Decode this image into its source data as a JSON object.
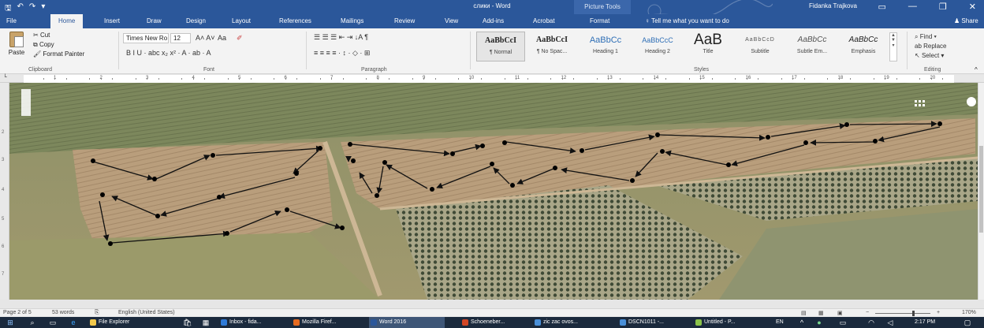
{
  "app": {
    "title": "слики - Word",
    "picture_tools": "Picture Tools",
    "user": "Fidanka Trajkova",
    "quick_access": [
      "save-icon",
      "undo-icon",
      "redo-icon",
      "customize-icon"
    ]
  },
  "tabs": [
    {
      "label": "File",
      "active": false
    },
    {
      "label": "Home",
      "active": true
    },
    {
      "label": "Insert",
      "active": false
    },
    {
      "label": "Draw",
      "active": false
    },
    {
      "label": "Design",
      "active": false
    },
    {
      "label": "Layout",
      "active": false
    },
    {
      "label": "References",
      "active": false
    },
    {
      "label": "Mailings",
      "active": false
    },
    {
      "label": "Review",
      "active": false
    },
    {
      "label": "View",
      "active": false
    },
    {
      "label": "Add-ins",
      "active": false
    },
    {
      "label": "Acrobat",
      "active": false
    },
    {
      "label": "Format",
      "active": false
    }
  ],
  "tell_me": "Tell me what you want to do",
  "share": "Share",
  "clipboard": {
    "paste": "Paste",
    "cut": "Cut",
    "copy": "Copy",
    "format_painter": "Format Painter",
    "group_label": "Clipboard"
  },
  "font": {
    "family": "Times New Ro",
    "size": "12",
    "change_case": "Aa",
    "group_label": "Font",
    "row2": "B  I  U  ·  abc  x₂  x²  ·  A  ·  ab  ·  A"
  },
  "paragraph": {
    "row1": "☰  ☰  ☰  ⇤  ⇥  ↓A  ¶",
    "row2": "≡  ≡  ≡  ≡  ·  ↕  ·  ◇  ·  ⊞",
    "group_label": "Paragraph"
  },
  "styles": {
    "items": [
      {
        "sample": "AaBbCcI",
        "name": "¶ Normal",
        "color": "#111111",
        "selected": true
      },
      {
        "sample": "AaBbCcI",
        "name": "¶ No Spac...",
        "color": "#111111",
        "selected": false
      },
      {
        "sample": "AaBbCc",
        "name": "Heading 1",
        "color": "#2f6fb6",
        "selected": false
      },
      {
        "sample": "AaBbCcC",
        "name": "Heading 2",
        "color": "#2f6fb6",
        "selected": false
      },
      {
        "sample": "AaB",
        "name": "Title",
        "color": "#222222",
        "selected": false
      },
      {
        "sample": "AaBbCcD",
        "name": "Subtitle",
        "color": "#555555",
        "selected": false
      },
      {
        "sample": "AaBbCc",
        "name": "Subtle Em...",
        "color": "#555555",
        "selected": false
      },
      {
        "sample": "AaBbCc",
        "name": "Emphasis",
        "color": "#333333",
        "selected": false
      }
    ],
    "group_label": "Styles"
  },
  "editing": {
    "find": "Find",
    "replace": "Replace",
    "select": "Select",
    "group_label": "Editing"
  },
  "ruler": {
    "numbers": [
      "1",
      "2",
      "3",
      "4",
      "5",
      "6",
      "7",
      "8",
      "9",
      "10",
      "11",
      "12",
      "13",
      "14",
      "15",
      "16",
      "17",
      "18",
      "19",
      "20"
    ]
  },
  "status": {
    "page": "Page 2 of 5",
    "words": "53 words",
    "language": "English (United States)",
    "zoom": "170%"
  },
  "taskbar": {
    "items": [
      {
        "label": "File Explorer",
        "color": "#f2c94c",
        "active": false
      },
      {
        "label": "Inbox - fida...",
        "color": "#2f7bd8",
        "active": false
      },
      {
        "label": "Mozilla Firef...",
        "color": "#e66a1f",
        "active": false
      },
      {
        "label": "Word 2016",
        "color": "#2b579a",
        "active": true
      },
      {
        "label": "Schoeneber...",
        "color": "#d24726",
        "active": false
      },
      {
        "label": "zic zac ovos...",
        "color": "#4a90d9",
        "active": false
      },
      {
        "label": "DSCN1011 -...",
        "color": "#4a90d9",
        "active": false
      },
      {
        "label": "Untitled - P...",
        "color": "#8bc34a",
        "active": false
      }
    ],
    "language": "EN",
    "time": "2:17 PM"
  },
  "colors": {
    "word_blue": "#2b579a",
    "ribbon_bg": "#f3f3f3",
    "taskbar": "#1b2a3d"
  }
}
